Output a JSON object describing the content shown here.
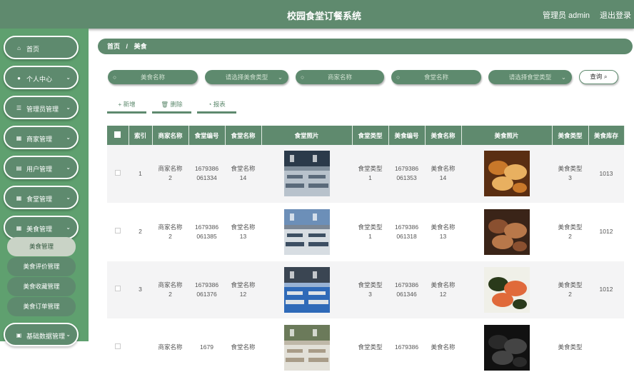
{
  "header": {
    "title": "校园食堂订餐系统",
    "user": "管理员 admin",
    "logout": "退出登录"
  },
  "sidebar": {
    "items": [
      {
        "label": "首页",
        "icon": "home-icon",
        "glyph": "⌂",
        "chevron": false
      },
      {
        "label": "个人中心",
        "icon": "person-icon",
        "glyph": "●",
        "chevron": true
      },
      {
        "label": "管理员管理",
        "icon": "list-icon",
        "glyph": "☰",
        "chevron": true
      },
      {
        "label": "商家管理",
        "icon": "grid-icon",
        "glyph": "▦",
        "chevron": true
      },
      {
        "label": "用户管理",
        "icon": "book-icon",
        "glyph": "▤",
        "chevron": true
      },
      {
        "label": "食堂管理",
        "icon": "grid-icon",
        "glyph": "▦",
        "chevron": true
      },
      {
        "label": "美食管理",
        "icon": "table-icon",
        "glyph": "▦",
        "chevron": true
      },
      {
        "label": "基础数据管理",
        "icon": "clipboard-icon",
        "glyph": "▣",
        "chevron": true
      }
    ],
    "submenu": [
      "美食管理",
      "美食评价管理",
      "美食收藏管理",
      "美食订单管理"
    ]
  },
  "breadcrumb": {
    "home": "首页",
    "sep": "/",
    "current": "美食"
  },
  "search": {
    "food_name": "美食名称",
    "food_type": "请选择美食类型",
    "merchant_name": "商家名称",
    "canteen_name": "食堂名称",
    "canteen_type": "请选择食堂类型",
    "query": "查询"
  },
  "actions": {
    "add": "新增",
    "delete": "删除",
    "report": "报表"
  },
  "table": {
    "headers": [
      "",
      "索引",
      "商家名称",
      "食堂编号",
      "食堂名称",
      "食堂照片",
      "食堂类型",
      "美食编号",
      "美食名称",
      "美食照片",
      "美食类型",
      "美食库存"
    ],
    "rows": [
      {
        "idx": "1",
        "merchant": "商家名称\n2",
        "canteen_no": "1679386\n061334",
        "canteen": "食堂名称\n14",
        "ctype": "食堂类型\n1",
        "food_no": "1679386\n061353",
        "food": "美食名称\n14",
        "ftype": "美食类型\n3",
        "stock": "1013"
      },
      {
        "idx": "2",
        "merchant": "商家名称\n2",
        "canteen_no": "1679386\n061385",
        "canteen": "食堂名称\n13",
        "ctype": "食堂类型\n1",
        "food_no": "1679386\n061318",
        "food": "美食名称\n13",
        "ftype": "美食类型\n2",
        "stock": "1012"
      },
      {
        "idx": "3",
        "merchant": "商家名称\n2",
        "canteen_no": "1679386\n061376",
        "canteen": "食堂名称\n12",
        "ctype": "食堂类型\n3",
        "food_no": "1679386\n061346",
        "food": "美食名称\n12",
        "ftype": "美食类型\n2",
        "stock": "1012"
      },
      {
        "idx": "",
        "merchant": "商家名称",
        "canteen_no": "1679",
        "canteen": "食堂名称",
        "ctype": "食堂类型",
        "food_no": "1679386",
        "food": "美食名称",
        "ftype": "美食类型",
        "stock": ""
      }
    ]
  },
  "colors": {
    "primary": "#5f8a6e",
    "sidebar": "#5fa06f"
  }
}
